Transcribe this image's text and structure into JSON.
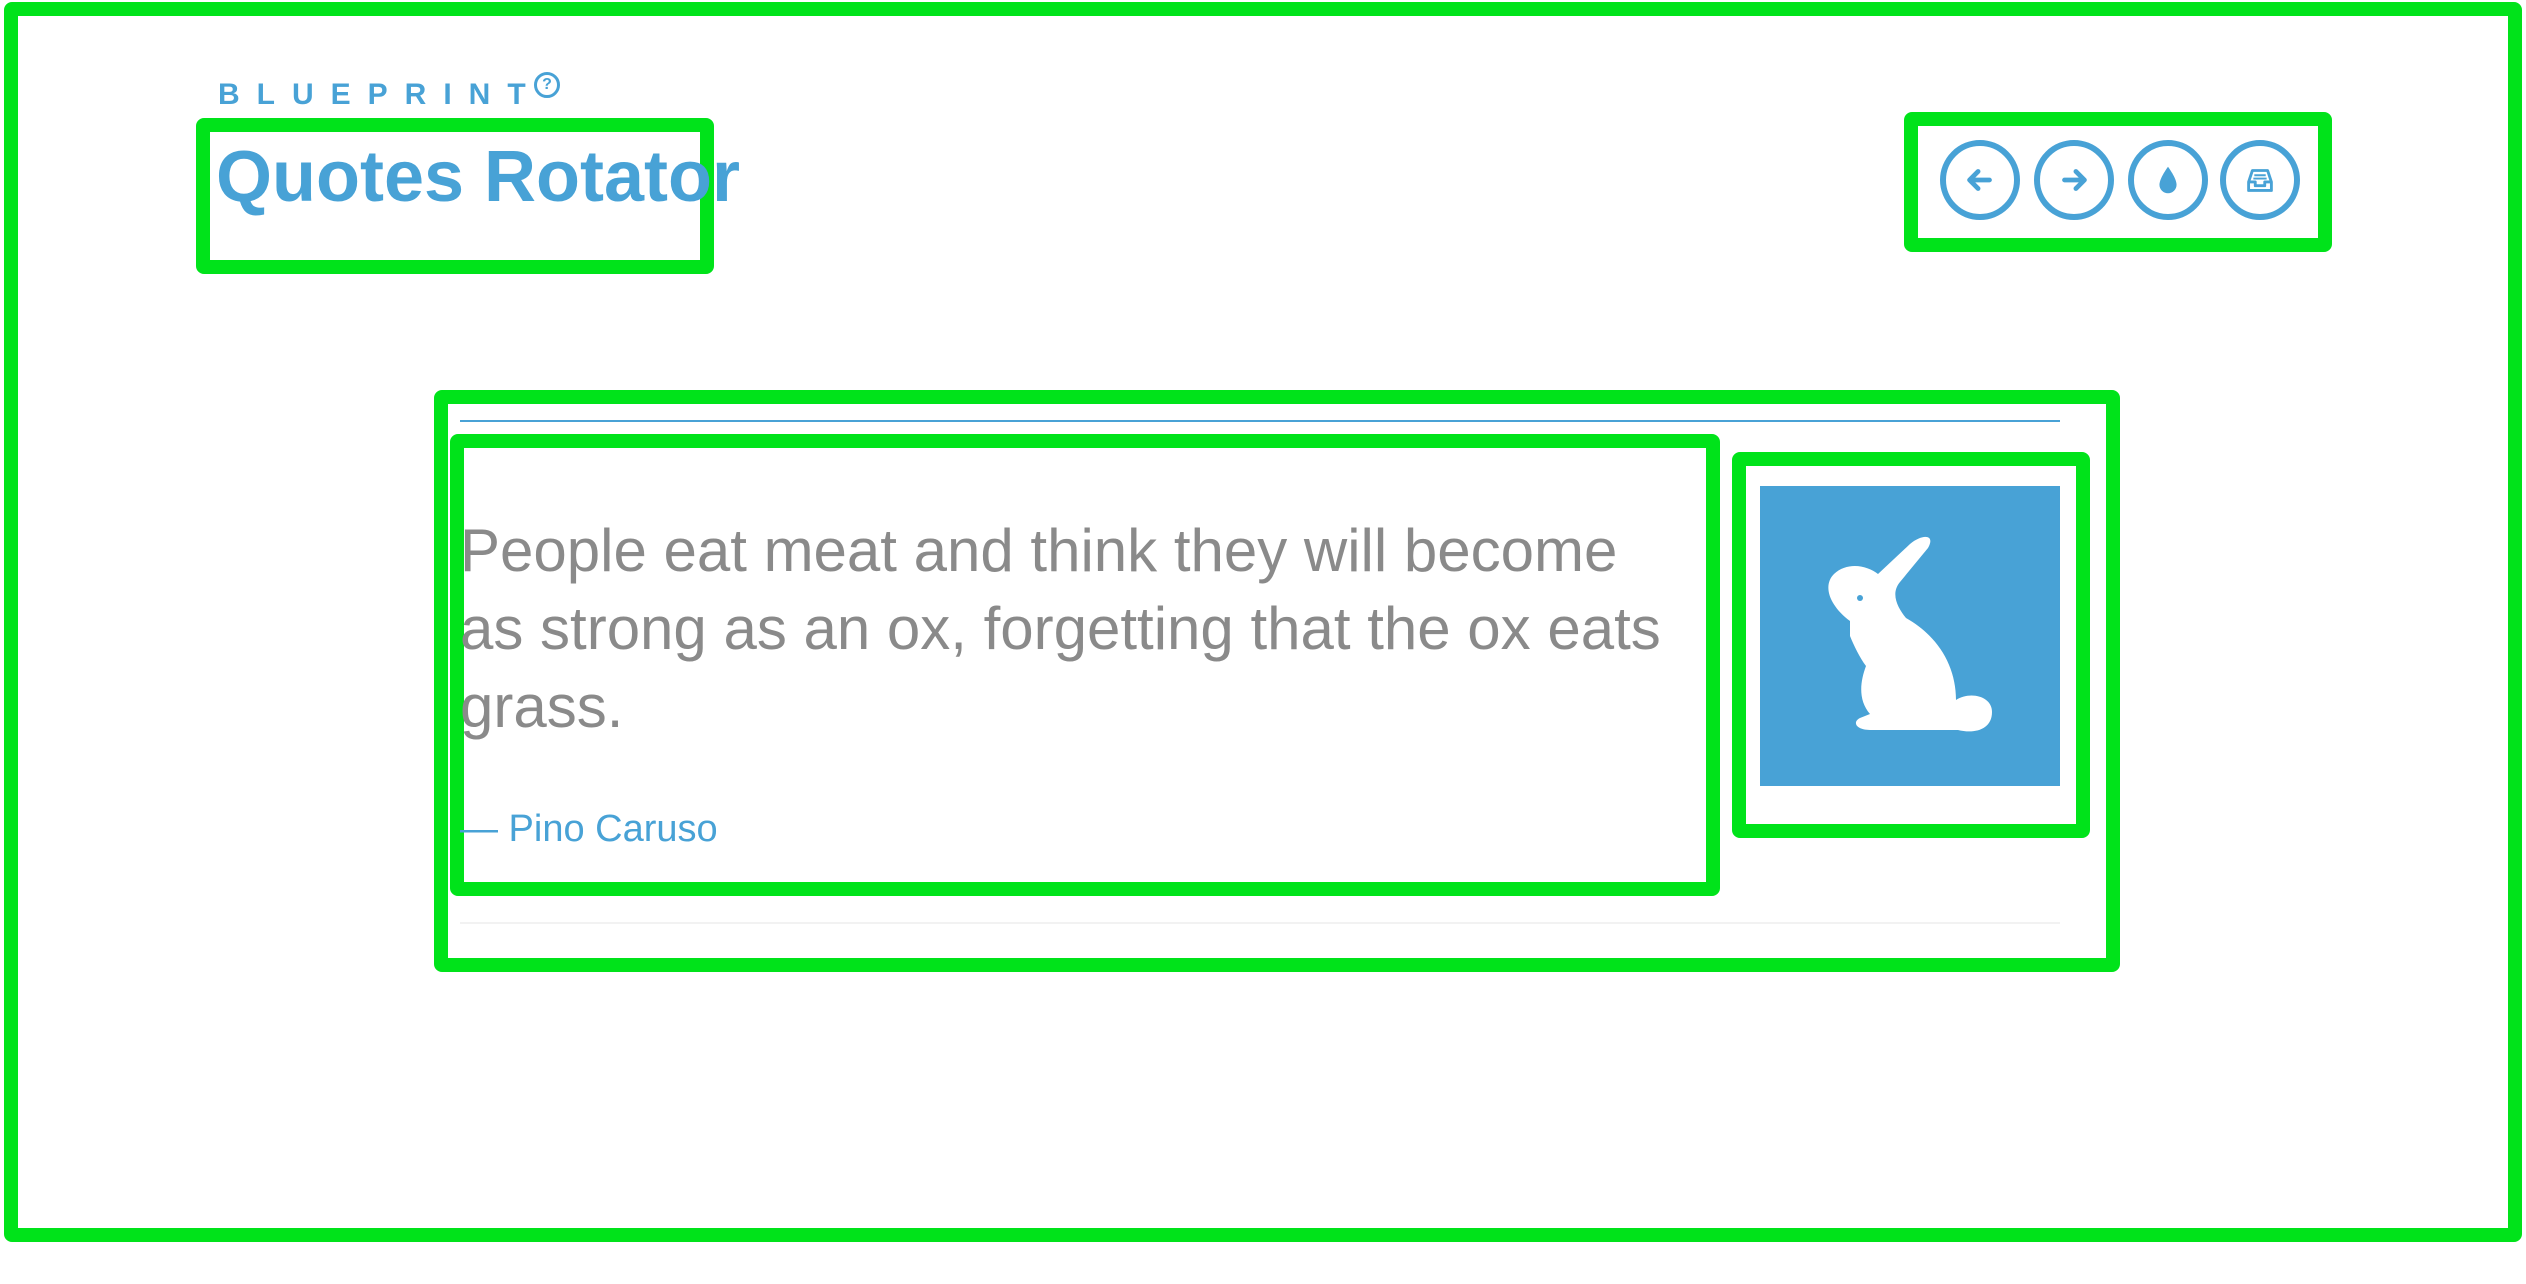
{
  "header": {
    "brand": "BLUEPRINT",
    "help_symbol": "?",
    "title": "Quotes Rotator"
  },
  "nav": {
    "buttons": [
      {
        "name": "previous",
        "icon": "arrow-left-icon"
      },
      {
        "name": "next",
        "icon": "arrow-right-icon"
      },
      {
        "name": "theme",
        "icon": "water-drop-icon"
      },
      {
        "name": "archive",
        "icon": "inbox-tray-icon"
      }
    ]
  },
  "quote": {
    "text": "People eat meat and think they will become as strong as an ox, forgetting that the ox eats grass.",
    "author": "— Pino Caruso",
    "image_icon": "rabbit-icon"
  },
  "colors": {
    "accent": "#48a2d6",
    "quote_text": "#8a8a8a",
    "highlight_box": "#00e31a"
  }
}
